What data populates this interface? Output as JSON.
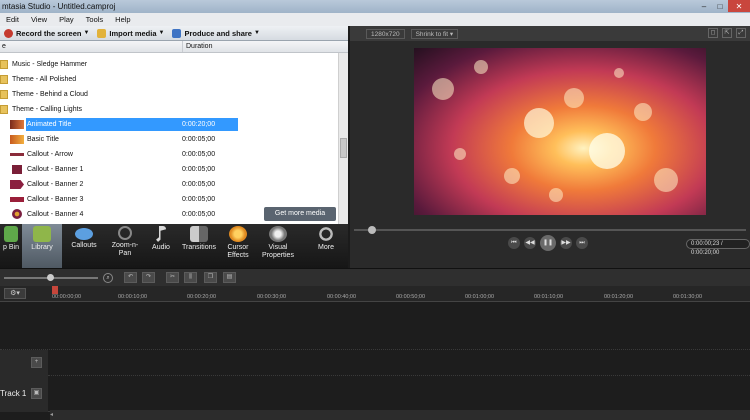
{
  "window": {
    "title": "mtasia Studio - Untitled.camproj",
    "controls": [
      "–",
      "□",
      "✕"
    ]
  },
  "menu": [
    "Edit",
    "View",
    "Play",
    "Tools",
    "Help"
  ],
  "toolbar": {
    "record_label": "Record the screen",
    "import_label": "Import media",
    "produce_label": "Produce and share"
  },
  "clipbin": {
    "col_name": "e",
    "col_duration": "Duration",
    "folders": [
      "Music - Sledge Hammer",
      "Theme - All Polished",
      "Theme - Behind a Cloud",
      "Theme - Calling Lights"
    ],
    "items": [
      {
        "name": "Animated Title",
        "duration": "0:00:20;00",
        "selected": true
      },
      {
        "name": "Basic Title",
        "duration": "0:00:05;00",
        "selected": false
      },
      {
        "name": "Callout - Arrow",
        "duration": "0:00:05;00",
        "selected": false
      },
      {
        "name": "Callout - Banner 1",
        "duration": "0:00:05;00",
        "selected": false
      },
      {
        "name": "Callout - Banner 2",
        "duration": "0:00:05;00",
        "selected": false
      },
      {
        "name": "Callout - Banner 3",
        "duration": "0:00:05;00",
        "selected": false
      },
      {
        "name": "Callout - Banner 4",
        "duration": "0:00:05;00",
        "selected": false
      }
    ],
    "get_more_media": "Get more media"
  },
  "tabs": [
    {
      "line1": "p Bin",
      "line2": "",
      "active": false
    },
    {
      "line1": "Library",
      "line2": "",
      "active": true
    },
    {
      "line1": "Callouts",
      "line2": "",
      "active": false
    },
    {
      "line1": "Zoom-n-",
      "line2": "Pan",
      "active": false
    },
    {
      "line1": "Audio",
      "line2": "",
      "active": false
    },
    {
      "line1": "Transitions",
      "line2": "",
      "active": false
    },
    {
      "line1": "Cursor",
      "line2": "Effects",
      "active": false
    },
    {
      "line1": "Visual",
      "line2": "Properties",
      "active": false
    },
    {
      "line1": "More",
      "line2": "",
      "active": false
    }
  ],
  "preview": {
    "size_label": "1280x720",
    "shrink_label": "Shrink to fit",
    "timecode": "0:00:00;23 / 0:00:20;00"
  },
  "timeline": {
    "ticks": [
      "00:00:00;00",
      "00:00:10;00",
      "00:00:20;00",
      "00:00:30;00",
      "00:00:40;00",
      "00:00:50;00",
      "00:01:00;00",
      "00:01:10;00",
      "00:01:20;00",
      "00:01:30;00"
    ],
    "track_label": "Track 1"
  },
  "colors": {
    "selection": "#3399ff",
    "active_tab": "#6f7b87",
    "playhead": "#c6463b"
  }
}
